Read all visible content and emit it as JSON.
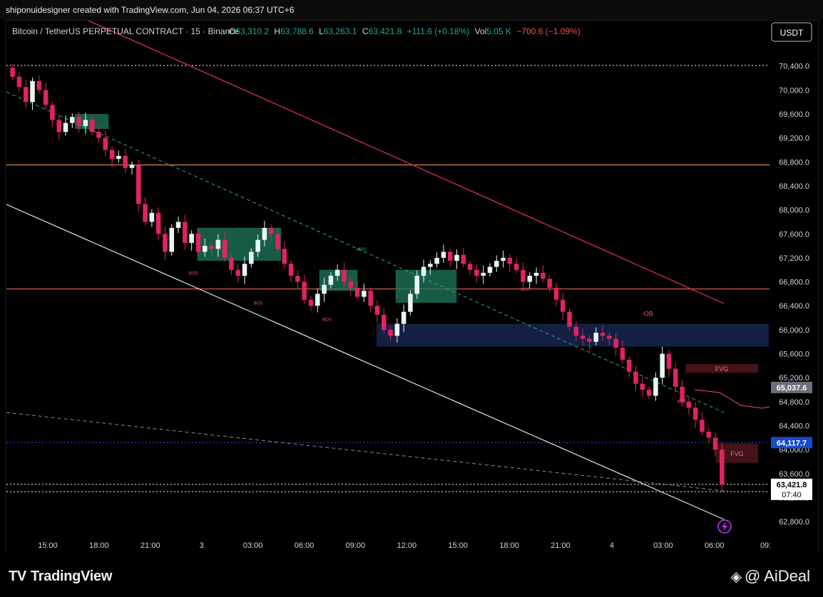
{
  "header": {
    "credit": "shiponuidesigner created with TradingView.com, Jun 04, 2026 06:37 UTC+6"
  },
  "legend": {
    "symbol": "Bitcoin / TetherUS PERPETUAL CONTRACT · 15 · Binance",
    "o_label": "O",
    "o_value": "63,310.2",
    "h_label": "H",
    "h_value": "63,788.6",
    "l_label": "L",
    "l_value": "63,263.1",
    "c_label": "C",
    "c_value": "63,421.8",
    "change": "+111.6 (+0.18%)",
    "vol_label": "Vol",
    "vol_value": "5.05 K",
    "vol_change": "−700.6 (−1.09%)"
  },
  "currency_button": "USDT",
  "brand": {
    "tradingview": "TradingView",
    "aideal": "@ AiDeal"
  },
  "chart_data": {
    "type": "candlestick",
    "symbol": "BTCUSDT.P",
    "timeframe": "15",
    "ylim": [
      62600,
      70800
    ],
    "y_ticks": [
      62800,
      63200,
      63600,
      64000,
      64400,
      64800,
      65200,
      65600,
      66000,
      66400,
      66800,
      67200,
      67600,
      68000,
      68400,
      68800,
      69200,
      69600,
      70000,
      70400
    ],
    "y_tick_labels": [
      "62,800.0",
      "63,200.0",
      "63,600.0",
      "64,000.0",
      "64,400.0",
      "64,800.0",
      "65,200.0",
      "65,600.0",
      "66,000.0",
      "66,400.0",
      "66,800.0",
      "67,200.0",
      "67,600.0",
      "68,000.0",
      "68,400.0",
      "68,800.0",
      "69,200.0",
      "69,600.0",
      "70,000.0",
      "70,400.0"
    ],
    "x_ticks": [
      "15:00",
      "18:00",
      "21:00",
      "3",
      "03:00",
      "06:00",
      "09:00",
      "12:00",
      "15:00",
      "18:00",
      "21:00",
      "4",
      "03:00",
      "06:00",
      "09:"
    ],
    "price_labels": [
      {
        "value": 65037.6,
        "text": "65,037.6",
        "color": "#6b6f7a"
      },
      {
        "value": 64117.7,
        "text": "64,117.7",
        "color": "#1848cc"
      },
      {
        "value": 63421.8,
        "text": "63,421.8",
        "sub": "07:40",
        "color": "#ffffff"
      }
    ],
    "horizontal_levels": [
      {
        "value": 68750,
        "color": "#f5a05a",
        "style": "solid"
      },
      {
        "value": 66680,
        "color": "#ff6b5a",
        "style": "solid"
      },
      {
        "value": 64117.7,
        "color": "#2d5bd6",
        "style": "dotted"
      },
      {
        "value": 70410,
        "color": "#ffffff",
        "style": "dotted"
      },
      {
        "value": 63421.8,
        "color": "#ffffff",
        "style": "dotted"
      },
      {
        "value": 63300,
        "color": "#ffffff",
        "style": "dotted"
      }
    ],
    "zones": [
      {
        "label": "",
        "x0": 0.09,
        "x1": 0.134,
        "y0": 69350,
        "y1": 69600,
        "color": "#1f7a5e"
      },
      {
        "label": "",
        "x0": 0.25,
        "x1": 0.36,
        "y0": 67150,
        "y1": 67700,
        "color": "#1f7a5e"
      },
      {
        "label": "",
        "x0": 0.41,
        "x1": 0.46,
        "y0": 66650,
        "y1": 67000,
        "color": "#1f7a5e"
      },
      {
        "label": "",
        "x0": 0.51,
        "x1": 0.59,
        "y0": 66450,
        "y1": 67000,
        "color": "#1f7a5e"
      },
      {
        "label": "",
        "x0": 0.485,
        "x1": 0.999,
        "y0": 65720,
        "y1": 66100,
        "color": "#1a2a5a"
      },
      {
        "label": "FVG",
        "x0": 0.89,
        "x1": 0.985,
        "y0": 65280,
        "y1": 65430,
        "color": "#5a1a22"
      },
      {
        "label": "FVG",
        "x0": 0.93,
        "x1": 0.985,
        "y0": 63780,
        "y1": 64100,
        "color": "#5a1a22"
      }
    ],
    "annotations": [
      {
        "text": "BOS",
        "x": 0.245,
        "y": 66920,
        "color": "#ff4d6d"
      },
      {
        "text": "BOS",
        "x": 0.33,
        "y": 66420,
        "color": "#ff4d6d"
      },
      {
        "text": "BOS",
        "x": 0.42,
        "y": 66150,
        "color": "#ff4d6d"
      },
      {
        "text": "MSS",
        "x": 0.465,
        "y": 67320,
        "color": "#22c77a"
      },
      {
        "text": "MSS",
        "x": 0.68,
        "y": 66650,
        "color": "#ff4d6d"
      },
      {
        "text": "-OB",
        "x": 0.84,
        "y": 66230,
        "color": "#ff4d6d"
      },
      {
        "text": "BOS",
        "x": 0.885,
        "y": 64780,
        "color": "#ff4d6d"
      }
    ],
    "candles_close": [
      70220,
      70050,
      69800,
      70150,
      70000,
      69750,
      69500,
      69300,
      69450,
      69550,
      69400,
      69500,
      69300,
      69200,
      69000,
      68850,
      68900,
      68700,
      68750,
      68100,
      67800,
      67950,
      67600,
      67300,
      67700,
      67800,
      67450,
      67600,
      67300,
      67400,
      67350,
      67500,
      67200,
      67000,
      66900,
      67100,
      67300,
      67500,
      67700,
      67600,
      67350,
      67100,
      66900,
      66800,
      66500,
      66400,
      66600,
      66750,
      66900,
      67000,
      66800,
      66700,
      66550,
      66650,
      66400,
      66250,
      66000,
      65900,
      66100,
      66300,
      66600,
      66900,
      67050,
      67100,
      67200,
      67300,
      67150,
      67250,
      67100,
      67000,
      66900,
      66950,
      67050,
      67150,
      67200,
      67100,
      67000,
      66800,
      66900,
      66950,
      66850,
      66700,
      66500,
      66300,
      66050,
      65900,
      65850,
      65800,
      65950,
      65900,
      65850,
      65700,
      65500,
      65300,
      65100,
      65000,
      64900,
      65200,
      65600,
      65350,
      65050,
      64800,
      64700,
      64500,
      64300,
      64200,
      64000,
      63420
    ]
  }
}
